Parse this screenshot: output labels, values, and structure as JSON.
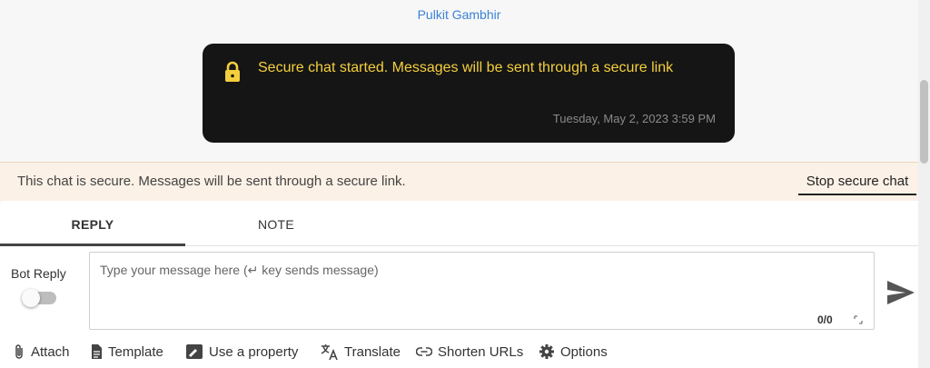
{
  "conversation": {
    "sender_name": "Pulkit Gambhir",
    "secure_message": {
      "icon": "lock-icon",
      "text": "Secure chat started. Messages will be sent through a secure link",
      "timestamp": "Tuesday, May 2, 2023 3:59 PM"
    }
  },
  "secure_banner": {
    "text": "This chat is secure. Messages will be sent through a secure link.",
    "stop_label": "Stop secure chat"
  },
  "composer": {
    "tabs": [
      {
        "label": "REPLY",
        "active": true
      },
      {
        "label": "NOTE",
        "active": false
      }
    ],
    "bot_reply": {
      "label": "Bot Reply",
      "enabled": false
    },
    "message_input": {
      "placeholder": "Type your message here (↵ key sends message)",
      "value": "",
      "char_count": "0/0"
    },
    "send_icon": "send-icon",
    "toolbar": [
      {
        "label": "Attach",
        "icon": "paperclip-icon"
      },
      {
        "label": "Template",
        "icon": "document-icon"
      },
      {
        "label": "Use a property",
        "icon": "property-icon"
      },
      {
        "label": "Translate",
        "icon": "translate-icon"
      },
      {
        "label": "Shorten URLs",
        "icon": "link-icon"
      },
      {
        "label": "Options",
        "icon": "gear-icon"
      }
    ]
  },
  "colors": {
    "accent_blue": "#3b82d6",
    "bubble_bg": "#151515",
    "bubble_text": "#f4cf3d",
    "banner_bg": "#fbf1e6"
  }
}
